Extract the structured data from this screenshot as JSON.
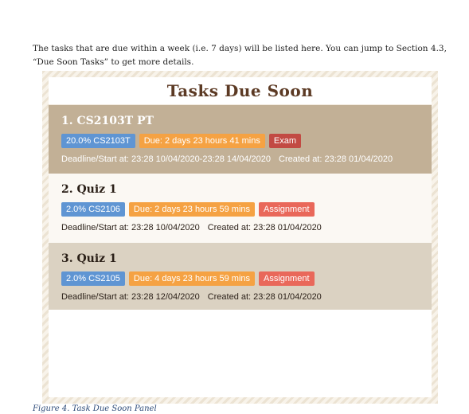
{
  "intro_text": "The tasks that are due within a week (i.e. 7 days) will be listed here. You can jump to Section 4.3, “Due Soon Tasks” to get more details.",
  "panel": {
    "title": "Tasks Due Soon",
    "tasks": [
      {
        "title": "1. CS2103T PT",
        "weight_tag": "20.0% CS2103T",
        "due_tag": "Due: 2 days 23 hours 41 mins",
        "type_tag": "Exam",
        "deadline": "Deadline/Start at: 23:28 10/04/2020-23:28 14/04/2020",
        "created": "Created at: 23:28 01/04/2020"
      },
      {
        "title": "2. Quiz 1",
        "weight_tag": "2.0% CS2106",
        "due_tag": "Due: 2 days 23 hours 59 mins",
        "type_tag": "Assignment",
        "deadline": "Deadline/Start at: 23:28 10/04/2020",
        "created": "Created at: 23:28 01/04/2020"
      },
      {
        "title": "3. Quiz 1",
        "weight_tag": "2.0% CS2105",
        "due_tag": "Due: 4 days 23 hours 59 mins",
        "type_tag": "Assignment",
        "deadline": "Deadline/Start at: 23:28 12/04/2020",
        "created": "Created at: 23:28 01/04/2020"
      }
    ]
  },
  "caption": "Figure 4. Task Due Soon Panel",
  "colors": {
    "weight_tag": "#5f95d3",
    "due_tag": "#f5a243",
    "exam_tag": "#c24a43",
    "assignment_tag": "#e9685a",
    "title_brown": "#5c3a24"
  }
}
